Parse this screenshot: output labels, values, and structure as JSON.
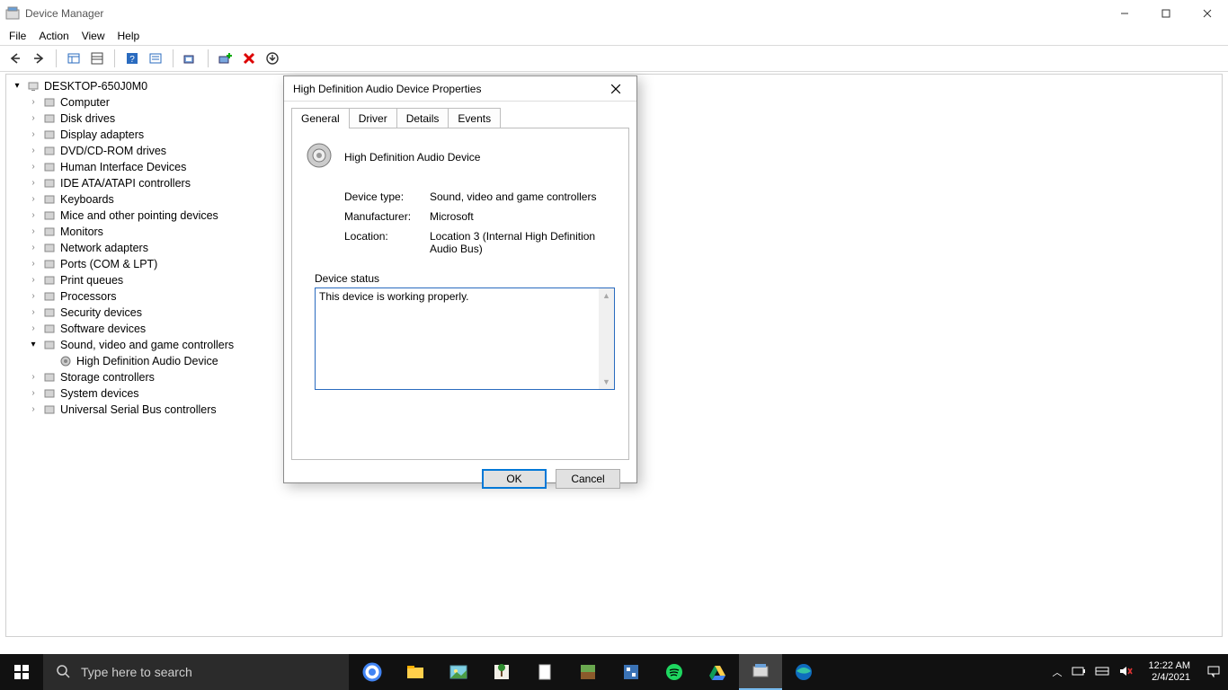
{
  "window": {
    "title": "Device Manager"
  },
  "menu": {
    "file": "File",
    "action": "Action",
    "view": "View",
    "help": "Help"
  },
  "tree": {
    "root": "DESKTOP-650J0M0",
    "items": [
      "Computer",
      "Disk drives",
      "Display adapters",
      "DVD/CD-ROM drives",
      "Human Interface Devices",
      "IDE ATA/ATAPI controllers",
      "Keyboards",
      "Mice and other pointing devices",
      "Monitors",
      "Network adapters",
      "Ports (COM & LPT)",
      "Print queues",
      "Processors",
      "Security devices",
      "Software devices",
      "Sound, video and game controllers",
      "Storage controllers",
      "System devices",
      "Universal Serial Bus controllers"
    ],
    "child_under_sound": "High Definition Audio Device"
  },
  "dialog": {
    "title": "High Definition Audio Device Properties",
    "tabs": {
      "general": "General",
      "driver": "Driver",
      "details": "Details",
      "events": "Events"
    },
    "device_name": "High Definition Audio Device",
    "rows": {
      "type_label": "Device type:",
      "type_value": "Sound, video and game controllers",
      "mfr_label": "Manufacturer:",
      "mfr_value": "Microsoft",
      "loc_label": "Location:",
      "loc_value": "Location 3 (Internal High Definition Audio Bus)"
    },
    "status_label": "Device status",
    "status_text": "This device is working properly.",
    "ok": "OK",
    "cancel": "Cancel"
  },
  "taskbar": {
    "search_placeholder": "Type here to search",
    "time": "12:22 AM",
    "date": "2/4/2021"
  }
}
